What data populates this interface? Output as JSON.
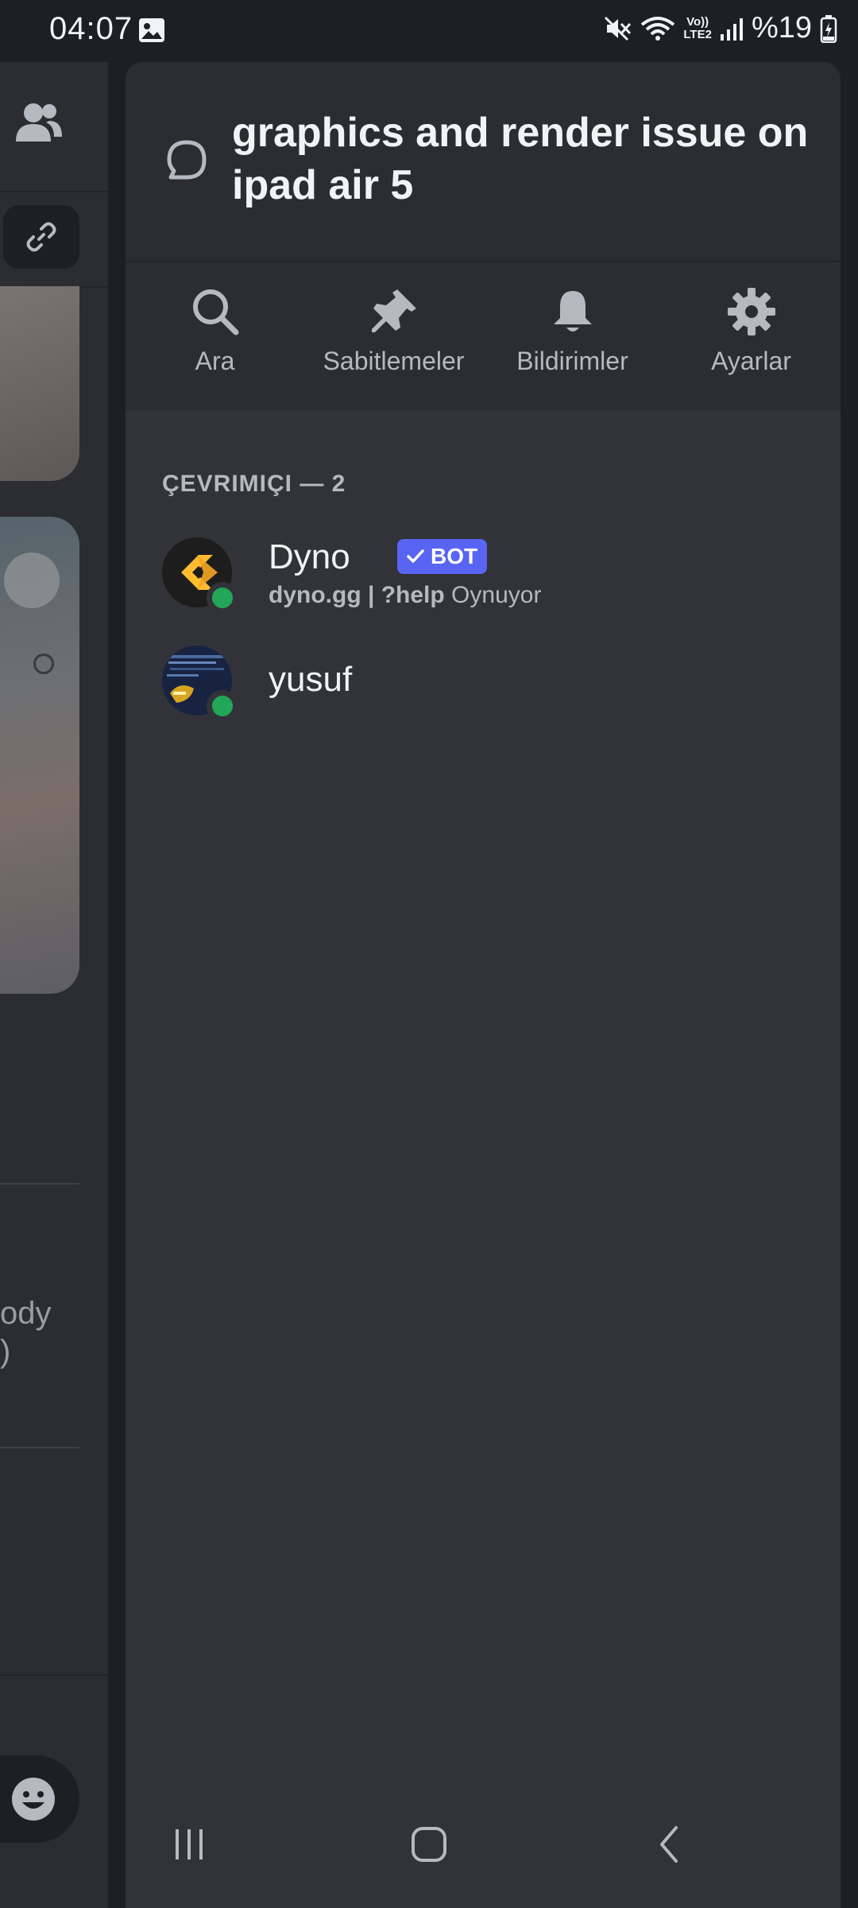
{
  "status_bar": {
    "time": "04:07",
    "volte_line1": "Vo))",
    "volte_line2": "LTE2",
    "battery_percent": "%19",
    "icons": [
      "image-icon",
      "mute-icon",
      "wifi-icon",
      "signal-icon",
      "battery-icon"
    ]
  },
  "background": {
    "partial_text_1": "ody",
    "partial_text_2": ")",
    "icons": [
      "members-icon",
      "link-icon",
      "emoji-icon"
    ]
  },
  "thread": {
    "icon": "thread-icon",
    "title": "graphics and render issue on ipad air 5"
  },
  "actions": [
    {
      "label": "Ara",
      "icon": "search-icon"
    },
    {
      "label": "Sabitlemeler",
      "icon": "pin-icon"
    },
    {
      "label": "Bildirimler",
      "icon": "bell-icon"
    },
    {
      "label": "Ayarlar",
      "icon": "gear-icon"
    }
  ],
  "members_section": {
    "label": "ÇEVRIMIÇI — 2",
    "members": [
      {
        "name": "Dyno",
        "badge": "BOT",
        "activity_strong": "dyno.gg | ?help",
        "activity_rest": " Oynuyor",
        "status": "online"
      },
      {
        "name": "yusuf",
        "status": "online"
      }
    ]
  },
  "navbar": {
    "icons": [
      "recent-apps-icon",
      "home-icon",
      "back-icon"
    ]
  },
  "colors": {
    "accent": "#5865f2",
    "online": "#23a55a",
    "drawer_bg": "#313338",
    "header_bg": "#2b2d31"
  }
}
